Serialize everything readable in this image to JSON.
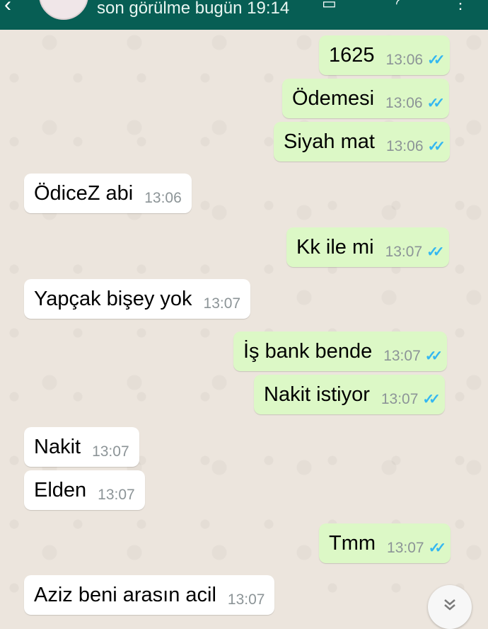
{
  "header": {
    "subtitle": "son görülme bugün 19:14",
    "back_icon": "‹"
  },
  "messages": [
    {
      "dir": "out",
      "text": "1625",
      "time": "13:06",
      "ticks": "✓✓"
    },
    {
      "dir": "out",
      "text": "Ödemesi",
      "time": "13:06",
      "ticks": "✓✓"
    },
    {
      "dir": "out",
      "text": "Siyah mat",
      "time": "13:06",
      "ticks": "✓✓"
    },
    {
      "dir": "in",
      "text": "ÖdiceZ abi",
      "time": "13:06"
    },
    {
      "dir": "out",
      "text": "Kk ile mi",
      "time": "13:07",
      "ticks": "✓✓"
    },
    {
      "dir": "in",
      "text": "Yapçak bişey yok",
      "time": "13:07"
    },
    {
      "dir": "out",
      "text": "İş bank bende",
      "time": "13:07",
      "ticks": "✓✓"
    },
    {
      "dir": "out",
      "text": "Nakit istiyor",
      "time": "13:07",
      "ticks": "✓✓"
    },
    {
      "dir": "in",
      "text": "Nakit",
      "time": "13:07"
    },
    {
      "dir": "in",
      "text": "Elden",
      "time": "13:07"
    },
    {
      "dir": "out",
      "text": "Tmm",
      "time": "13:07",
      "ticks": "✓✓"
    },
    {
      "dir": "in",
      "text": "Aziz beni arasın acil",
      "time": "13:07"
    }
  ],
  "scroll_button": {
    "icon": "double-chevron-down-icon",
    "glyph": "⌄"
  },
  "colors": {
    "header": "#075e54",
    "outgoing": "#dcf8c6",
    "incoming": "#ffffff",
    "read_ticks": "#34b7f1"
  }
}
